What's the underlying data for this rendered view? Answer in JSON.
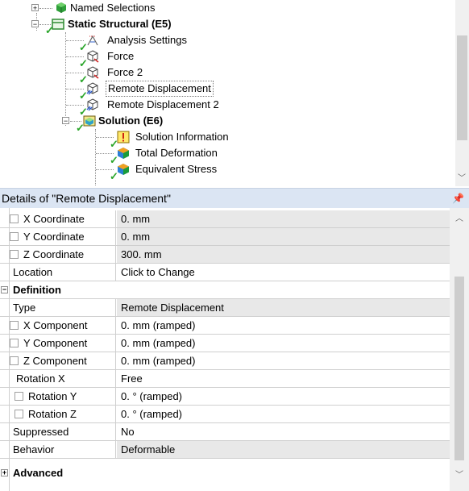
{
  "tree": {
    "nodes": [
      {
        "label": "Named Selections"
      },
      {
        "label": "Static Structural (E5)"
      },
      {
        "label": "Analysis Settings"
      },
      {
        "label": "Force"
      },
      {
        "label": "Force 2"
      },
      {
        "label": "Remote Displacement"
      },
      {
        "label": "Remote Displacement 2"
      },
      {
        "label": "Solution (E6)"
      },
      {
        "label": "Solution Information"
      },
      {
        "label": "Total Deformation"
      },
      {
        "label": "Equivalent Stress"
      }
    ],
    "expand_plus": "+",
    "expand_minus": "−"
  },
  "details": {
    "title": "Details of \"Remote Displacement\"",
    "pin": "ᵖ",
    "rows": [
      {
        "label": "X Coordinate",
        "value": "0. mm"
      },
      {
        "label": "Y Coordinate",
        "value": "0. mm"
      },
      {
        "label": "Z Coordinate",
        "value": "300. mm"
      },
      {
        "label": "Location",
        "value": "Click to Change"
      },
      {
        "label": "Definition",
        "value": ""
      },
      {
        "label": "Type",
        "value": "Remote Displacement"
      },
      {
        "label": "X Component",
        "value": "0. mm  (ramped)"
      },
      {
        "label": "Y Component",
        "value": "0. mm  (ramped)"
      },
      {
        "label": "Z Component",
        "value": "0. mm  (ramped)"
      },
      {
        "label": "Rotation X",
        "value": "Free"
      },
      {
        "label": "Rotation Y",
        "value": "0. °  (ramped)"
      },
      {
        "label": "Rotation Z",
        "value": "0. °  (ramped)"
      },
      {
        "label": "Suppressed",
        "value": "No"
      },
      {
        "label": "Behavior",
        "value": "Deformable"
      },
      {
        "label": "Advanced",
        "value": ""
      }
    ],
    "section_minus": "−",
    "section_plus": "+"
  },
  "colors": {
    "check": "#2aa52a",
    "header_bg": "#dbe5f3",
    "grey_cell": "#e8e8e8"
  },
  "icons": [
    "named-selections-icon",
    "static-structural-icon",
    "analysis-settings-icon",
    "force-icon",
    "remote-displacement-icon",
    "solution-icon",
    "solution-information-icon",
    "result-icon",
    "checkmark-icon",
    "pin-icon"
  ]
}
